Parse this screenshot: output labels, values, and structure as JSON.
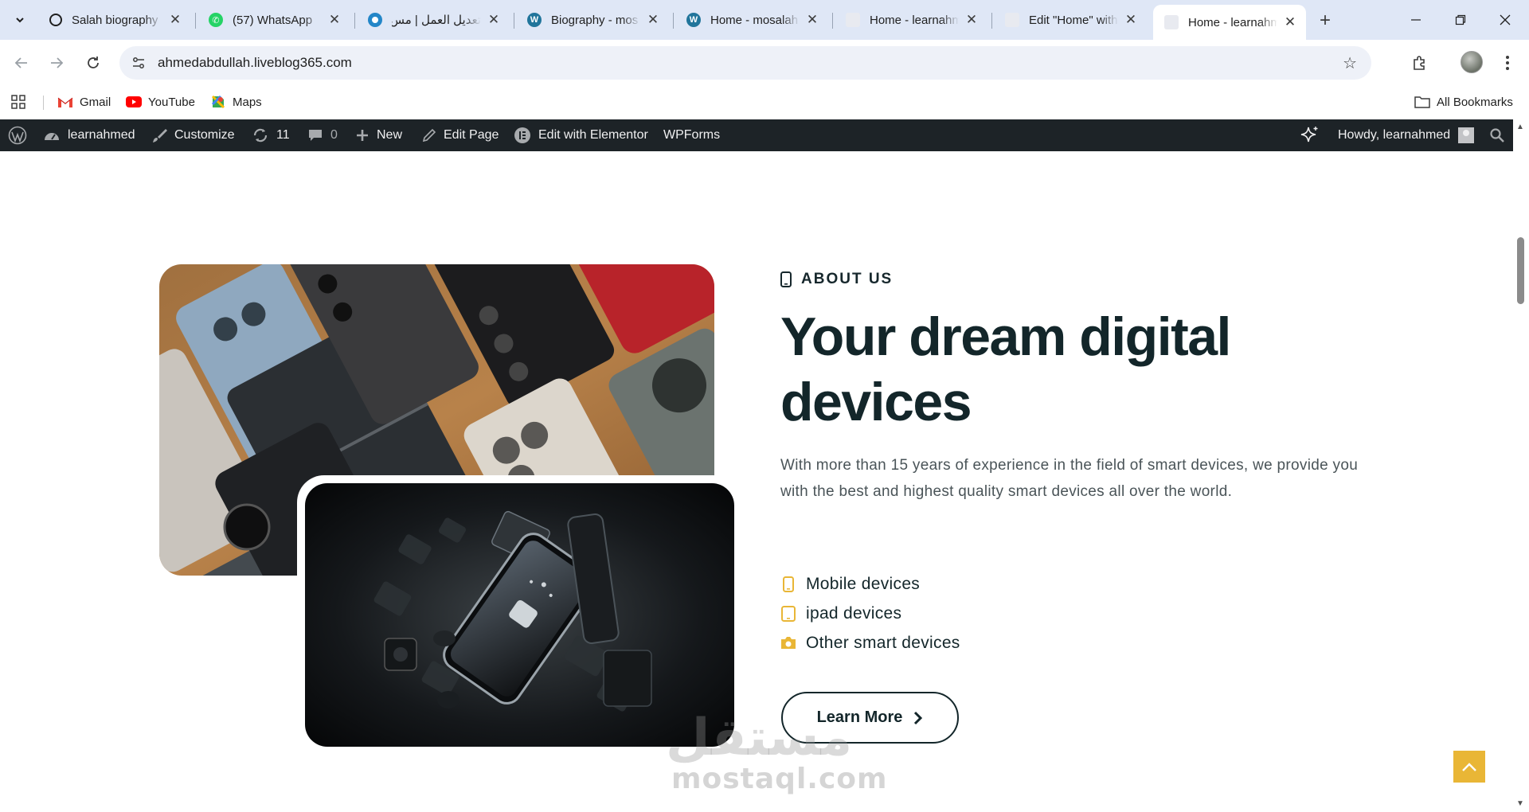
{
  "browser": {
    "tabs": [
      {
        "title": "Salah biography",
        "favicon": "chatgpt-icon",
        "active": false
      },
      {
        "title": "(57) WhatsApp",
        "favicon": "whatsapp-icon",
        "active": false
      },
      {
        "title": "تعديل العمل | مس",
        "favicon": "mostaql-icon",
        "active": false
      },
      {
        "title": "Biography - mos",
        "favicon": "wordpress-icon",
        "active": false
      },
      {
        "title": "Home - mosalah",
        "favicon": "wordpress-icon",
        "active": false
      },
      {
        "title": "Home - learnahm",
        "favicon": "page-icon",
        "active": false
      },
      {
        "title": "Edit \"Home\" with",
        "favicon": "page-icon",
        "active": false
      },
      {
        "title": "Home - learnahm",
        "favicon": "page-icon",
        "active": true
      }
    ],
    "new_tab_label": "+",
    "url": "ahmedabdullah.liveblog365.com",
    "bookmarks": [
      {
        "label": "Gmail",
        "icon": "gmail-icon"
      },
      {
        "label": "YouTube",
        "icon": "youtube-icon"
      },
      {
        "label": "Maps",
        "icon": "maps-icon"
      }
    ],
    "all_bookmarks_label": "All Bookmarks"
  },
  "admin_bar": {
    "site_name": "learnahmed",
    "customize": "Customize",
    "updates_count": "11",
    "comments_count": "0",
    "new": "New",
    "edit_page": "Edit Page",
    "edit_elementor": "Edit with Elementor",
    "wpforms": "WPForms",
    "howdy": "Howdy, learnahmed"
  },
  "about": {
    "eyebrow": "ABOUT US",
    "headline": "Your dream digital devices",
    "paragraph": "With more than 15 years of experience in the field of smart devices, we provide you with the best and highest quality smart devices all over the world.",
    "features": [
      {
        "label": "Mobile devices",
        "icon": "mobile-icon"
      },
      {
        "label": "ipad devices",
        "icon": "tablet-icon"
      },
      {
        "label": "Other smart devices",
        "icon": "camera-icon"
      }
    ],
    "button_label": "Learn More"
  },
  "watermark": {
    "arabic": "مستقل",
    "latin": "mostaql.com"
  },
  "colors": {
    "accent": "#e9b636",
    "heading": "#13262a",
    "admin_bar": "#1d2327",
    "tabstrip": "#dfe7f6"
  }
}
